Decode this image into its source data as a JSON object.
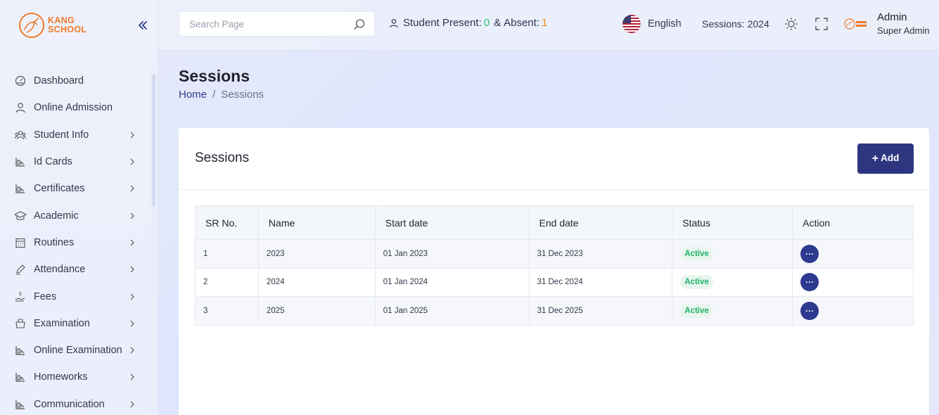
{
  "brand": {
    "line1": "KANG",
    "line2": "SCHOOL"
  },
  "colors": {
    "accent": "#2e3680",
    "brand": "#f07a2a",
    "active": "#1fb16a"
  },
  "sidebar": {
    "collapse_icon": "double-chevron-left-icon",
    "items": [
      {
        "label": "Dashboard",
        "icon": "dashboard-icon",
        "has_children": false
      },
      {
        "label": "Online Admission",
        "icon": "user-icon",
        "has_children": false
      },
      {
        "label": "Student Info",
        "icon": "students-icon",
        "has_children": true
      },
      {
        "label": "Id Cards",
        "icon": "chart-icon",
        "has_children": true
      },
      {
        "label": "Certificates",
        "icon": "chart-icon",
        "has_children": true
      },
      {
        "label": "Academic",
        "icon": "graduation-cap-icon",
        "has_children": true
      },
      {
        "label": "Routines",
        "icon": "calendar-icon",
        "has_children": true
      },
      {
        "label": "Attendance",
        "icon": "pen-icon",
        "has_children": true
      },
      {
        "label": "Fees",
        "icon": "fees-icon",
        "has_children": true
      },
      {
        "label": "Examination",
        "icon": "exam-icon",
        "has_children": true
      },
      {
        "label": "Online Examination",
        "icon": "chart-icon",
        "has_children": true
      },
      {
        "label": "Homeworks",
        "icon": "chart-icon",
        "has_children": true
      },
      {
        "label": "Communication",
        "icon": "chart-icon",
        "has_children": true
      }
    ]
  },
  "header": {
    "search_placeholder": "Search Page",
    "presence": {
      "present_label": "Student Present:",
      "present_count": "0",
      "separator": "&",
      "absent_label": "Absent:",
      "absent_count": "1"
    },
    "language": "English",
    "session": "Sessions: 2024",
    "user_name": "Admin",
    "user_role": "Super Admin"
  },
  "page": {
    "title": "Sessions",
    "breadcrumb": {
      "home": "Home",
      "sep": "/",
      "current": "Sessions"
    }
  },
  "card": {
    "title": "Sessions",
    "add_label": "Add",
    "columns": [
      "SR No.",
      "Name",
      "Start date",
      "End date",
      "Status",
      "Action"
    ],
    "rows": [
      {
        "sr": "1",
        "name": "2023",
        "start": "01 Jan 2023",
        "end": "31 Dec 2023",
        "status": "Active",
        "action": "···"
      },
      {
        "sr": "2",
        "name": "2024",
        "start": "01 Jan 2024",
        "end": "31 Dec 2024",
        "status": "Active",
        "action": "···"
      },
      {
        "sr": "3",
        "name": "2025",
        "start": "01 Jan 2025",
        "end": "31 Dec 2025",
        "status": "Active",
        "action": "···"
      }
    ]
  }
}
